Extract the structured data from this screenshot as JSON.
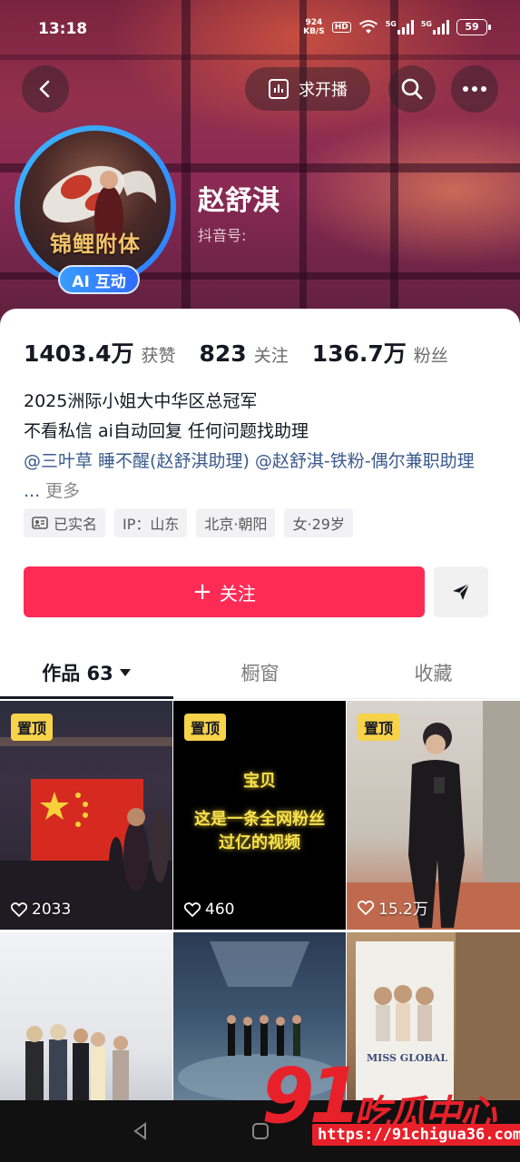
{
  "status_bar": {
    "time": "13:18",
    "net_speed_value": "924",
    "net_speed_unit": "KB/S",
    "hd": "HD",
    "sig1_label": "5G",
    "sig2_label": "5G",
    "battery": "59"
  },
  "header": {
    "live_label": "求开播",
    "back_icon": "chevron-left-icon",
    "search_icon": "search-icon",
    "more_icon": "more-dots-icon"
  },
  "profile": {
    "name": "赵舒淇",
    "douyin_id_label": "抖音号:",
    "avatar_title": "锦鲤附体",
    "ai_badge": "AI 互动"
  },
  "stats": [
    {
      "value": "1403.4万",
      "label": "获赞"
    },
    {
      "value": "823",
      "label": "关注"
    },
    {
      "value": "136.7万",
      "label": "粉丝"
    }
  ],
  "bio": {
    "line1": "2025洲际小姐大中华区总冠军",
    "line2": "不看私信 ai自动回复 任何问题找助理",
    "mention1": "@三叶草 睡不醒(赵舒淇助理)",
    "mention2": "@赵舒淇-铁粉-偶尔兼职助理",
    "ellipsis": "...",
    "more": "更多"
  },
  "tags": {
    "verified": "已实名",
    "ip": "IP：山东",
    "location": "北京·朝阳",
    "gender_age": "女·29岁"
  },
  "actions": {
    "follow": "关注",
    "plus": "+"
  },
  "tabs": [
    {
      "label": "作品 63"
    },
    {
      "label": "橱窗"
    },
    {
      "label": "收藏"
    }
  ],
  "videos": [
    {
      "pinned": "置顶",
      "likes": "2033"
    },
    {
      "pinned": "置顶",
      "likes": "460",
      "overlay_line1": "宝贝",
      "overlay_line2": "这是一条全网粉丝",
      "overlay_line3": "过亿的视频"
    },
    {
      "pinned": "置顶",
      "likes": "15.2万"
    },
    {},
    {},
    {
      "poster_text": "MISS GLOBAL"
    }
  ],
  "watermark": {
    "num": "91",
    "text": "吃瓜中心",
    "url": "https://91chigua36.com"
  },
  "colors": {
    "follow_red": "#fe2c55",
    "pin_yellow": "#f7d34a",
    "mention_blue": "#3a5a8c"
  }
}
